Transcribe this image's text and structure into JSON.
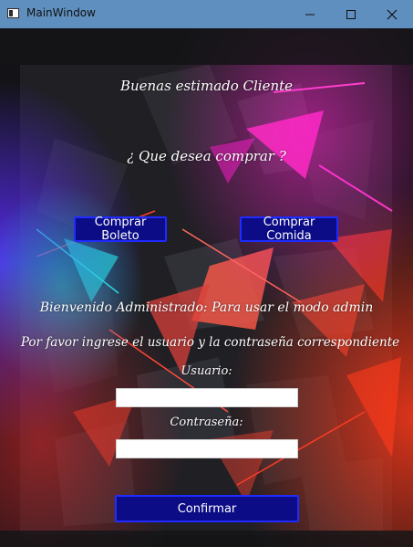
{
  "window": {
    "title": "MainWindow",
    "controls": [
      "minimize-icon",
      "maximize-icon",
      "close-icon"
    ]
  },
  "client": {
    "greeting": "Buenas estimado Cliente",
    "question": "¿ Que desea comprar ?",
    "buttons": {
      "comprar_boleto": "Comprar Boleto",
      "comprar_comida": "Comprar Comida",
      "confirmar": "Confirmar"
    },
    "admin_line1": "Bienvenido Administrado: Para usar el modo admin",
    "admin_line2": "Por favor ingrese el usuario y la contraseña correspondiente",
    "usuario_label": "Usuario:",
    "usuario_value": "",
    "contrasena_label": "Contraseña:",
    "contrasena_value": ""
  },
  "colors": {
    "titlebar": "#5f8fbf",
    "button_fill": "#0c0c86",
    "button_border": "#1f2bff",
    "accent_magenta": "#ff2fbf",
    "accent_red": "#ff3b2f",
    "accent_cyan": "#1fe0c8"
  }
}
